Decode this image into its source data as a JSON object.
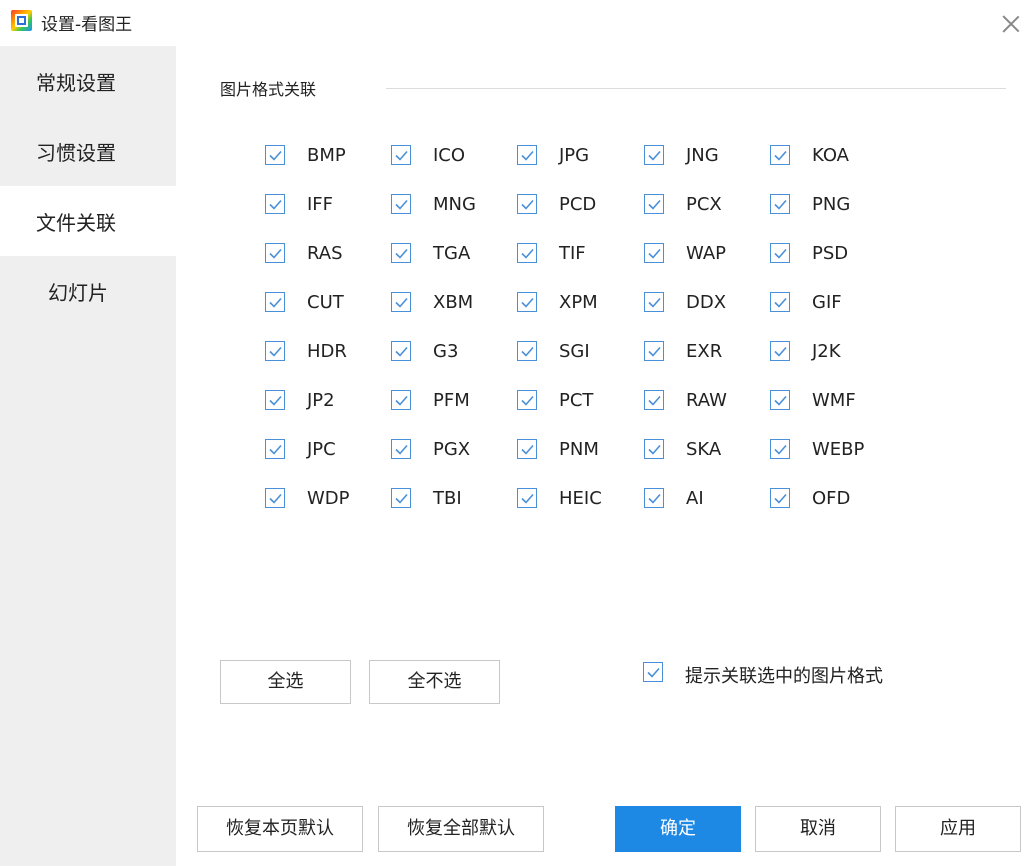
{
  "window": {
    "title": "设置-看图王"
  },
  "sidebar": {
    "items": [
      {
        "label": "常规设置"
      },
      {
        "label": "习惯设置"
      },
      {
        "label": "文件关联"
      },
      {
        "label": "幻灯片"
      }
    ],
    "active_index": 2
  },
  "section": {
    "title": "图片格式关联"
  },
  "formats": [
    [
      "BMP",
      "ICO",
      "JPG",
      "JNG",
      "KOA"
    ],
    [
      "IFF",
      "MNG",
      "PCD",
      "PCX",
      "PNG"
    ],
    [
      "RAS",
      "TGA",
      "TIF",
      "WAP",
      "PSD"
    ],
    [
      "CUT",
      "XBM",
      "XPM",
      "DDX",
      "GIF"
    ],
    [
      "HDR",
      "G3",
      "SGI",
      "EXR",
      "J2K"
    ],
    [
      "JP2",
      "PFM",
      "PCT",
      "RAW",
      "WMF"
    ],
    [
      "JPC",
      "PGX",
      "PNM",
      "SKA",
      "WEBP"
    ],
    [
      "WDP",
      "TBI",
      "HEIC",
      "AI",
      "OFD"
    ]
  ],
  "all_checked": true,
  "buttons": {
    "select_all": "全选",
    "select_none": "全不选",
    "restore_page": "恢复本页默认",
    "restore_all": "恢复全部默认",
    "ok": "确定",
    "cancel": "取消",
    "apply": "应用"
  },
  "hint": {
    "label": "提示关联选中的图片格式",
    "checked": true
  },
  "colors": {
    "accent": "#1e88e5",
    "checkbox_border": "#4a90d9",
    "sidebar_bg": "#efefef"
  }
}
